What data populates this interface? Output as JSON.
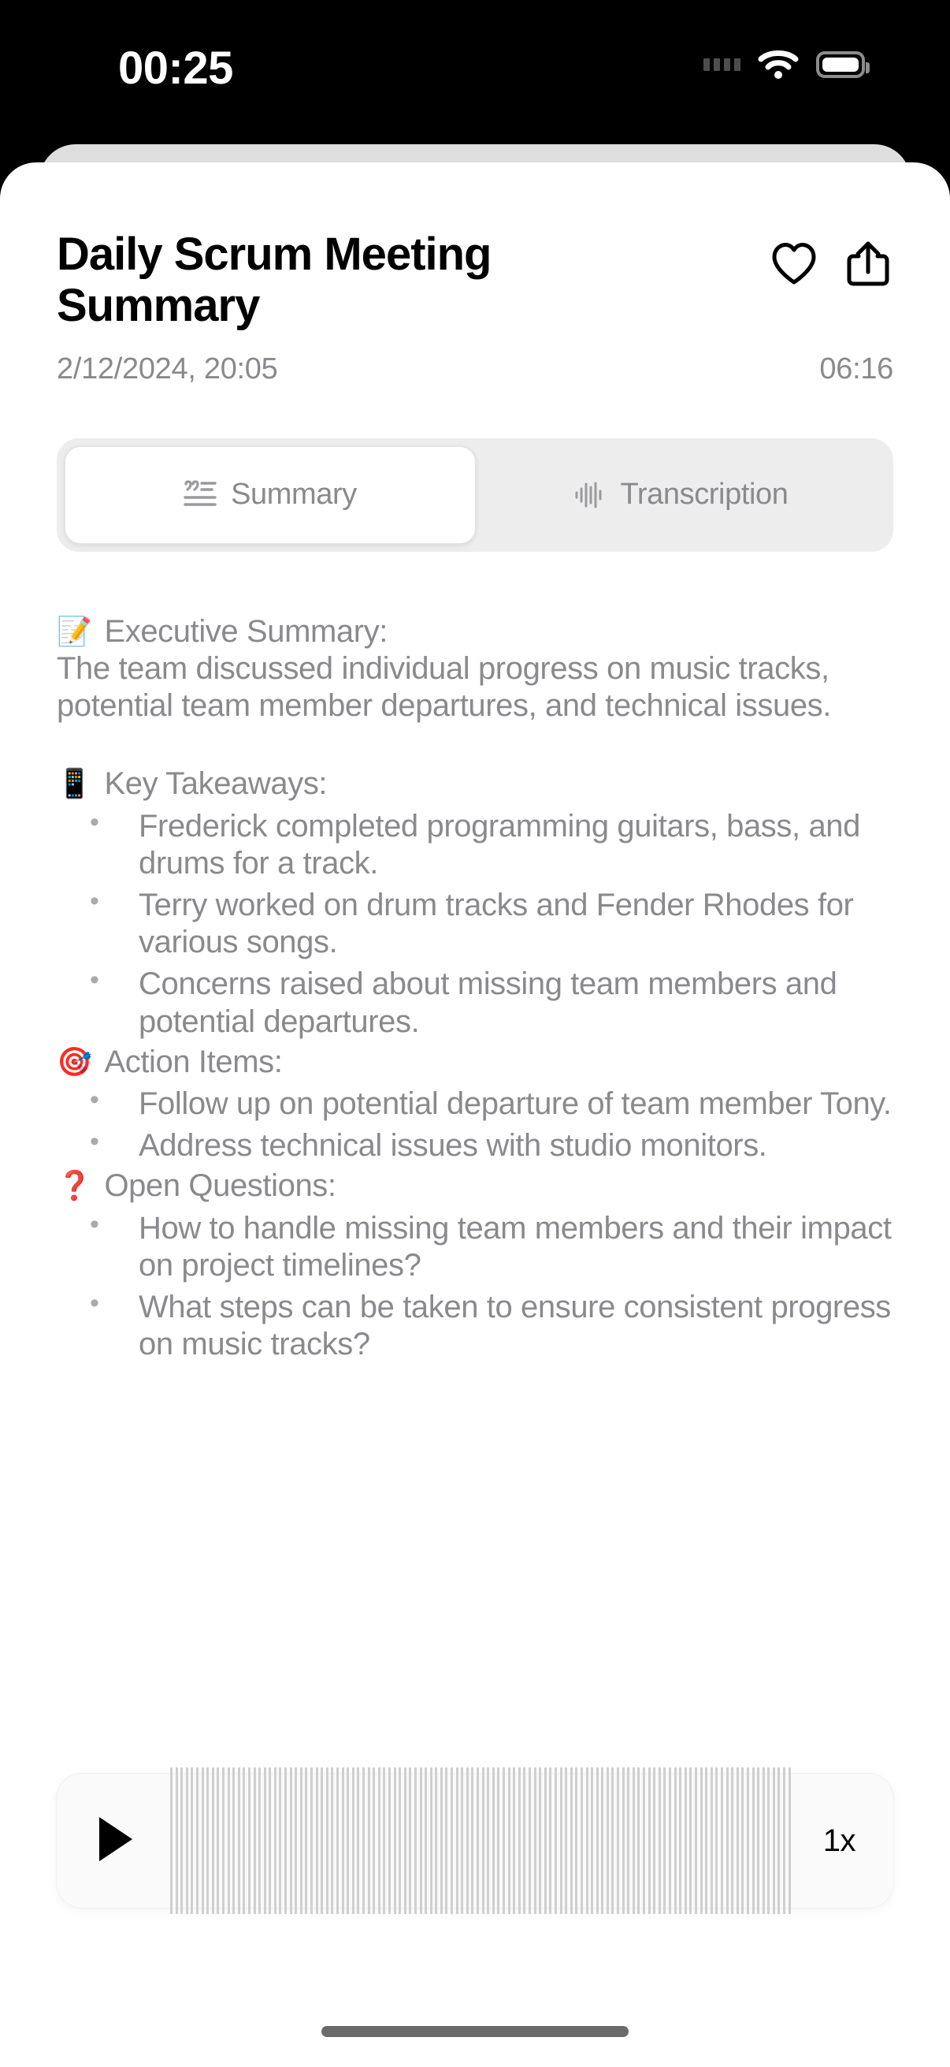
{
  "status_bar": {
    "time": "00:25",
    "signal_icon": "signal-dots-icon",
    "wifi_icon": "wifi-icon",
    "battery_icon": "battery-full-icon"
  },
  "header": {
    "title": "Daily Scrum Meeting Summary",
    "date": "2/12/2024, 20:05",
    "duration": "06:16",
    "favorite_icon": "heart-icon",
    "share_icon": "share-icon"
  },
  "tabs": [
    {
      "label": "Summary",
      "icon": "text-quote-icon",
      "active": true
    },
    {
      "label": "Transcription",
      "icon": "waveform-icon",
      "active": false
    }
  ],
  "summary": {
    "sections": [
      {
        "emoji": "📝",
        "emoji_name": "memo-emoji",
        "heading": "Executive Summary:",
        "paragraph": "The team discussed individual progress on music tracks, potential team member departures, and technical issues.",
        "bullets": []
      },
      {
        "emoji": "📱",
        "emoji_name": "mobile-phone-emoji",
        "heading": "Key Takeaways:",
        "paragraph": "",
        "bullets": [
          "Frederick completed programming guitars, bass, and drums for a track.",
          "Terry worked on drum tracks and Fender Rhodes for various songs.",
          "Concerns raised about missing team members and potential departures."
        ]
      },
      {
        "emoji": "🎯",
        "emoji_name": "dart-target-emoji",
        "heading": "Action Items:",
        "paragraph": "",
        "bullets": [
          "Follow up on potential departure of team member Tony.",
          "Address technical issues with studio monitors."
        ]
      },
      {
        "emoji": "❓",
        "emoji_name": "red-question-mark-emoji",
        "heading": "Open Questions:",
        "paragraph": "",
        "bullets": [
          "How to handle missing team members and their impact on project timelines?",
          "What steps can be taken to ensure consistent progress on music tracks?"
        ]
      }
    ]
  },
  "player": {
    "play_icon": "play-icon",
    "waveform_icon": "audio-waveform-track",
    "speed_label": "1x",
    "waveform_bar_count": 120
  },
  "colors": {
    "background": "#000000",
    "sheet": "#ffffff",
    "peek_card": "#dedede",
    "title_text": "#000000",
    "muted_text": "#8a8a8e",
    "segment_track": "#ededed",
    "segment_active": "#ffffff",
    "waveform_bar": "#cfcfcf",
    "player_card": "#fafafa",
    "home_indicator": "#6b6b6b"
  }
}
